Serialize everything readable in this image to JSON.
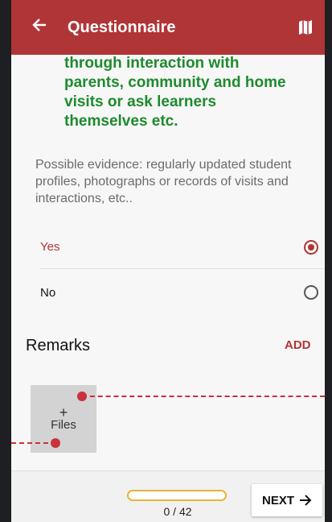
{
  "header": {
    "title": "Questionnaire",
    "back_icon": "arrow-left-icon",
    "map_icon": "map-icon",
    "bg_color": "#b03537"
  },
  "question": {
    "text": "through interaction with\nparents, community and home\nvisits or ask learners\nthemselves etc.",
    "color": "#1e8a2e"
  },
  "evidence": {
    "text": "Possible evidence: regularly updated student profiles, photographs or records of visits and interactions, etc.."
  },
  "options": [
    {
      "label": "Yes",
      "selected": true
    },
    {
      "label": "No",
      "selected": false
    }
  ],
  "remarks": {
    "title": "Remarks",
    "add_label": "ADD"
  },
  "files": {
    "plus": "+",
    "label": "Files"
  },
  "footer": {
    "progress_text": "0 / 42",
    "progress_fraction": 0,
    "next_label": "NEXT",
    "next_icon": "arrow-right-icon"
  }
}
